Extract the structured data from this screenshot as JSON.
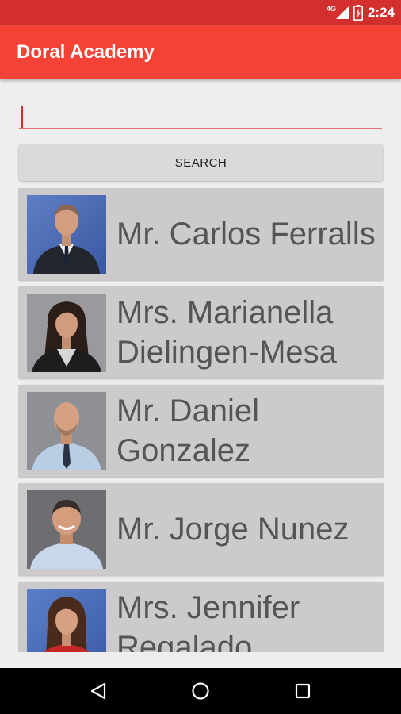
{
  "status_bar": {
    "network": "4G",
    "time": "2:24"
  },
  "app_bar": {
    "title": "Doral Academy"
  },
  "search": {
    "value": "",
    "placeholder": "",
    "button_label": "SEARCH"
  },
  "staff": [
    {
      "name": "Mr. Carlos Ferralls",
      "photo": "portrait-man-blue-background"
    },
    {
      "name": "Mrs. Marianella Dielingen-Mesa",
      "photo": "portrait-woman-gray-background"
    },
    {
      "name": "Mr. Daniel Gonzalez",
      "photo": "portrait-man-gray-background"
    },
    {
      "name": "Mr. Jorge Nunez",
      "photo": "portrait-man-dark-background"
    },
    {
      "name": "Mrs. Jennifer Regalado",
      "photo": "portrait-woman-blue-background"
    }
  ],
  "colors": {
    "primary": "#f44336",
    "primary_dark": "#d32f2f",
    "card": "#cccaca",
    "name_text": "#555555"
  },
  "nav": {
    "back": "back-icon",
    "home": "home-icon",
    "recents": "recents-icon"
  }
}
